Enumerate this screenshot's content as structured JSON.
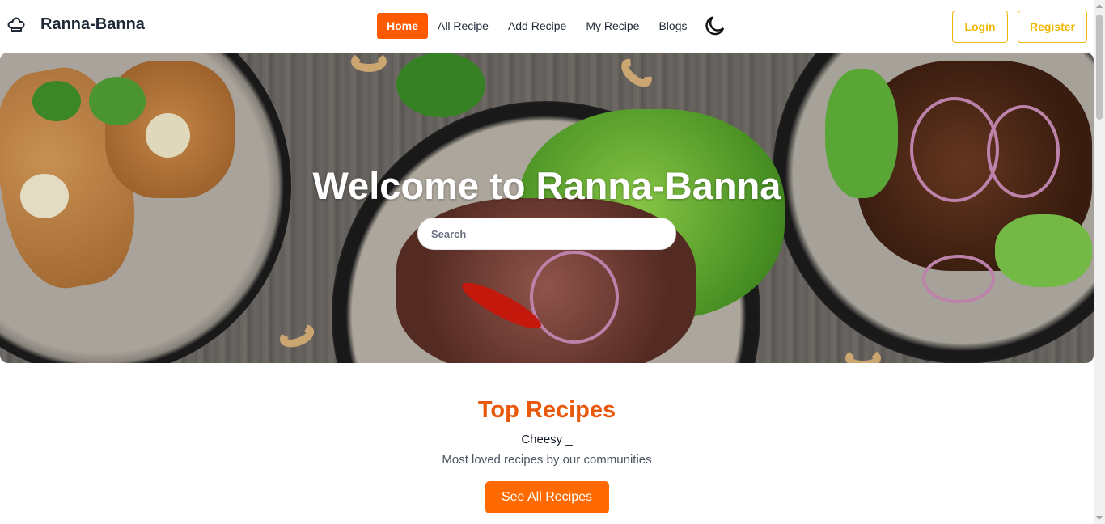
{
  "navbar": {
    "brand_name": "Ranna-Banna",
    "brand_icon": "chef-hat-icon",
    "menu": [
      {
        "label": "Home",
        "active": true
      },
      {
        "label": "All Recipe",
        "active": false
      },
      {
        "label": "Add Recipe",
        "active": false
      },
      {
        "label": "My Recipe",
        "active": false
      },
      {
        "label": "Blogs",
        "active": false
      }
    ],
    "theme_icon": "moon-icon",
    "login_label": "Login",
    "register_label": "Register"
  },
  "hero": {
    "title": "Welcome to Ranna-Banna",
    "search_placeholder": "Search"
  },
  "top_recipes": {
    "title": "Top Recipes",
    "typing_text": "Cheesy _",
    "description": "Most loved recipes by our communities",
    "button_label": "See All Recipes"
  },
  "colors": {
    "accent": "#ff5a00",
    "title_orange": "#ea580c",
    "outline_yellow": "#f2b705"
  }
}
